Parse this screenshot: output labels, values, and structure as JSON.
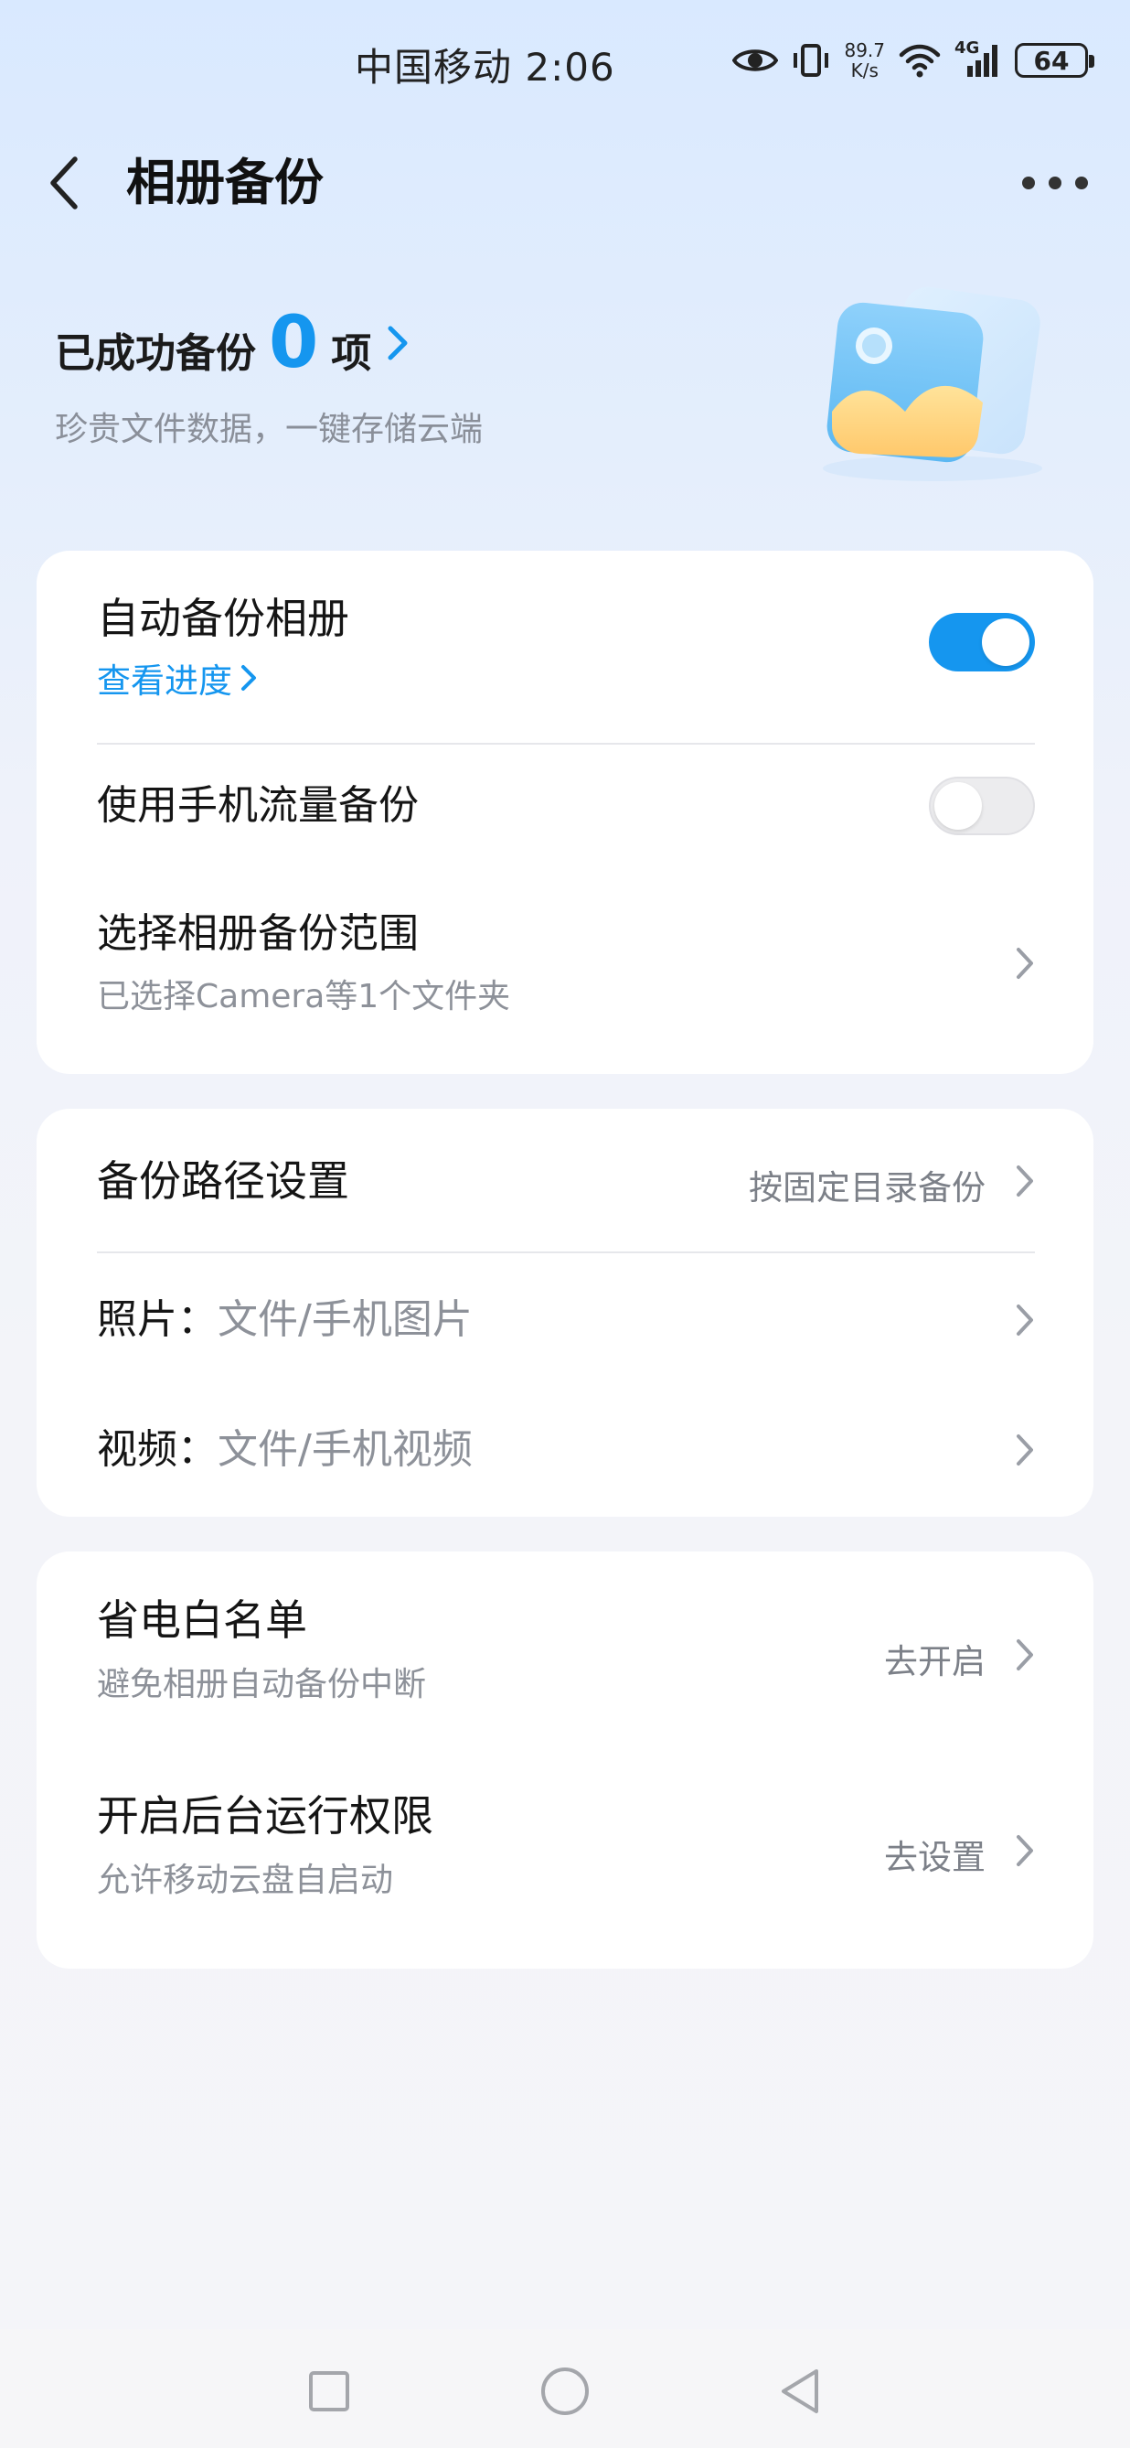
{
  "status_bar": {
    "carrier_time": "中国移动 2:06",
    "net_speed_value": "89.7",
    "net_speed_unit": "K/s",
    "signal_label": "4G",
    "battery": "64"
  },
  "header": {
    "title": "相册备份"
  },
  "hero": {
    "label": "已成功备份",
    "count": "0",
    "unit": "项",
    "subtitle": "珍贵文件数据，一键存储云端"
  },
  "auto_backup": {
    "title": "自动备份相册",
    "progress_link": "查看进度",
    "enabled": true
  },
  "mobile_data": {
    "title": "使用手机流量备份",
    "enabled": false
  },
  "backup_scope": {
    "title": "选择相册备份范围",
    "subtitle": "已选择Camera等1个文件夹"
  },
  "backup_path": {
    "title": "备份路径设置",
    "value": "按固定目录备份",
    "photo_label": "照片：",
    "photo_value": "文件/手机图片",
    "video_label": "视频：",
    "video_value": "文件/手机视频"
  },
  "power_whitelist": {
    "title": "省电白名单",
    "subtitle": "避免相册自动备份中断",
    "action": "去开启"
  },
  "background_permission": {
    "title": "开启后台运行权限",
    "subtitle": "允许移动云盘自启动",
    "action": "去设置"
  },
  "colors": {
    "accent": "#1596ef",
    "background_top": "#d9e9ff",
    "card": "#ffffff"
  }
}
